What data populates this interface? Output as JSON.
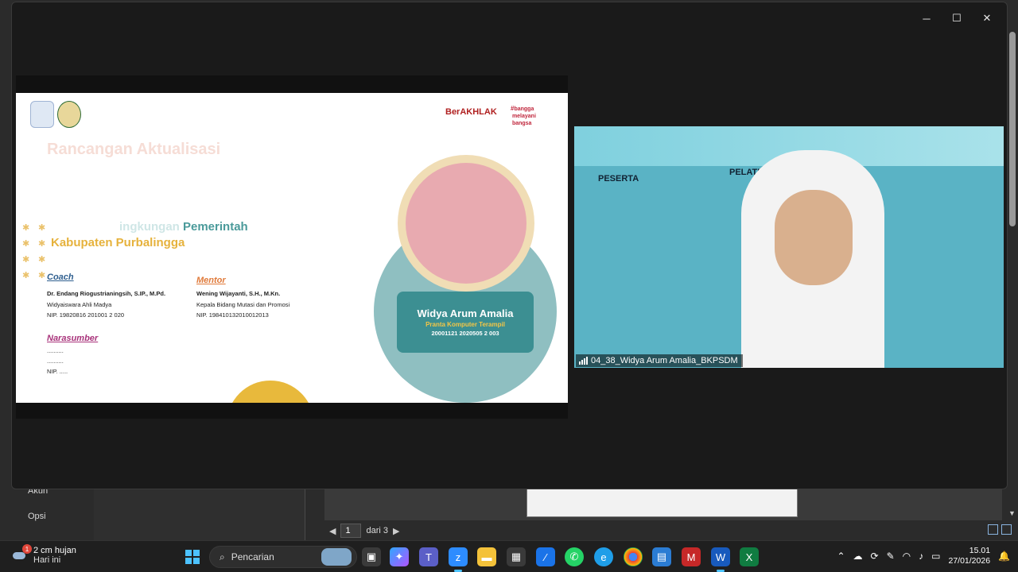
{
  "background_app": {
    "menu": [
      "Akun",
      "Opsi"
    ],
    "page_input": "1",
    "page_total": "dari 3"
  },
  "zoom": {
    "window_controls": {
      "minimize": "─",
      "maximize": "☐",
      "close": "✕"
    },
    "slide": {
      "title": "Rancangan Aktualisasi",
      "subtitle_faded": "ingkungan",
      "subtitle_line1": "Pemerintah",
      "subtitle_line2": "Kabupaten Purbalingga",
      "brand1": "BerAKHLAK",
      "brand2": "#bangga melayani bangsa",
      "coach": {
        "heading": "Coach",
        "name": "Dr. Endang Riogustrianingsih, S.IP., M.Pd.",
        "role": "Widyaiswara Ahli Madya",
        "nip": "NIP. 19820816 201001 2 020"
      },
      "mentor": {
        "heading": "Mentor",
        "name": "Wening Wijayanti, S.H., M.Kn.",
        "role": "Kepala Bidang Mutasi dan Promosi",
        "nip": "NIP. 198410132010012013"
      },
      "narasumber": {
        "heading": "Narasumber",
        "line1": "..........",
        "line2": "..........",
        "line3": "NIP. ....."
      },
      "name_card": {
        "name": "Widya Arum Amalia",
        "role": "Pranta Komputer Terampil",
        "nip": "20001121 2020505 2 003"
      }
    },
    "video": {
      "peserta": "PESERTA",
      "pelatihan": "PELATIHAN D",
      "participant_label": "04_38_Widya Arum Amalia_BKPSDM"
    }
  },
  "taskbar": {
    "weather_temp": "2 cm hujan",
    "weather_sub": "Hari ini",
    "weather_badge": "1",
    "search_placeholder": "Pencarian",
    "time": "15.01",
    "date": "27/01/2026"
  }
}
